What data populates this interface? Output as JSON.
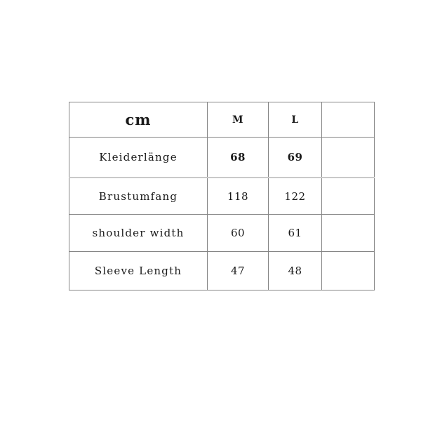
{
  "document": {
    "type": "size-chart-table",
    "background_color": "#ffffff",
    "border_color": "#858585",
    "light_border_color": "#c9c9c9",
    "text_color": "#1a1a1a"
  },
  "table": {
    "unit_label": "cm",
    "columns": [
      {
        "key": "measure",
        "header": "cm"
      },
      {
        "key": "m",
        "header": "M"
      },
      {
        "key": "l",
        "header": "L"
      },
      {
        "key": "blank",
        "header": ""
      }
    ],
    "rows": [
      {
        "label": "Kleiderlänge",
        "m": "68",
        "l": "69",
        "blank": "",
        "emphasis": true
      },
      {
        "label": "Brustumfang",
        "m": "118",
        "l": "122",
        "blank": "",
        "emphasis": false
      },
      {
        "label": "shoulder width",
        "m": "60",
        "l": "61",
        "blank": "",
        "emphasis": false
      },
      {
        "label": "Sleeve Length",
        "m": "47",
        "l": "48",
        "blank": "",
        "emphasis": false
      }
    ]
  }
}
